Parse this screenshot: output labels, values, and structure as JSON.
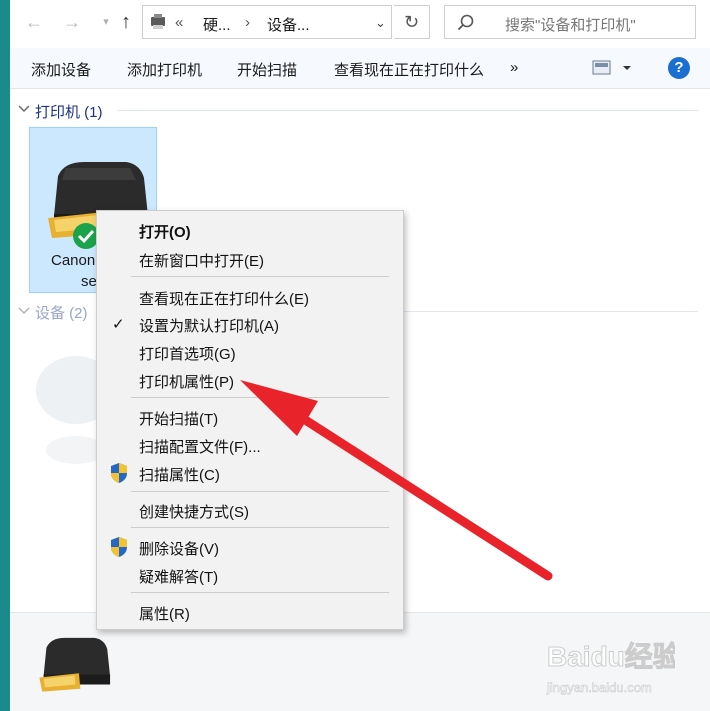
{
  "address_bar": {
    "back_icon": "arrow-left",
    "forward_icon": "arrow-right",
    "recent_icon": "chevron-down",
    "up_icon": "arrow-up",
    "overflow": "«",
    "crumbs": [
      "硬...",
      "设备..."
    ],
    "sep": "›",
    "dropdown_icon": "chevron-down",
    "refresh_icon": "refresh",
    "search_placeholder": "搜索\"设备和打印机\""
  },
  "toolbar": {
    "items": [
      "添加设备",
      "添加打印机",
      "开始扫描",
      "查看现在正在打印什么"
    ],
    "more": "»",
    "help_label": "?"
  },
  "groups": {
    "printers_header": "打印机 (1)",
    "devices_header": "设备 (2)"
  },
  "printer_tile": {
    "name_line1": "Canon T",
    "name_line2": "seri",
    "status_icon": "check-circle"
  },
  "context_menu": {
    "items": [
      "打开(O)",
      "在新窗口中打开(E)",
      "查看现在正在打印什么(E)",
      "设置为默认打印机(A)",
      "打印首选项(G)",
      "打印机属性(P)",
      "开始扫描(T)",
      "扫描配置文件(F)...",
      "扫描属性(C)",
      "创建快捷方式(S)",
      "删除设备(V)",
      "疑难解答(T)",
      "属性(R)"
    ],
    "checkmark": "✓"
  },
  "annotation": {
    "arrow_color": "#e8242a"
  },
  "watermark": {
    "brand": "Baidu经验",
    "url": "jingyan.baidu.com"
  }
}
